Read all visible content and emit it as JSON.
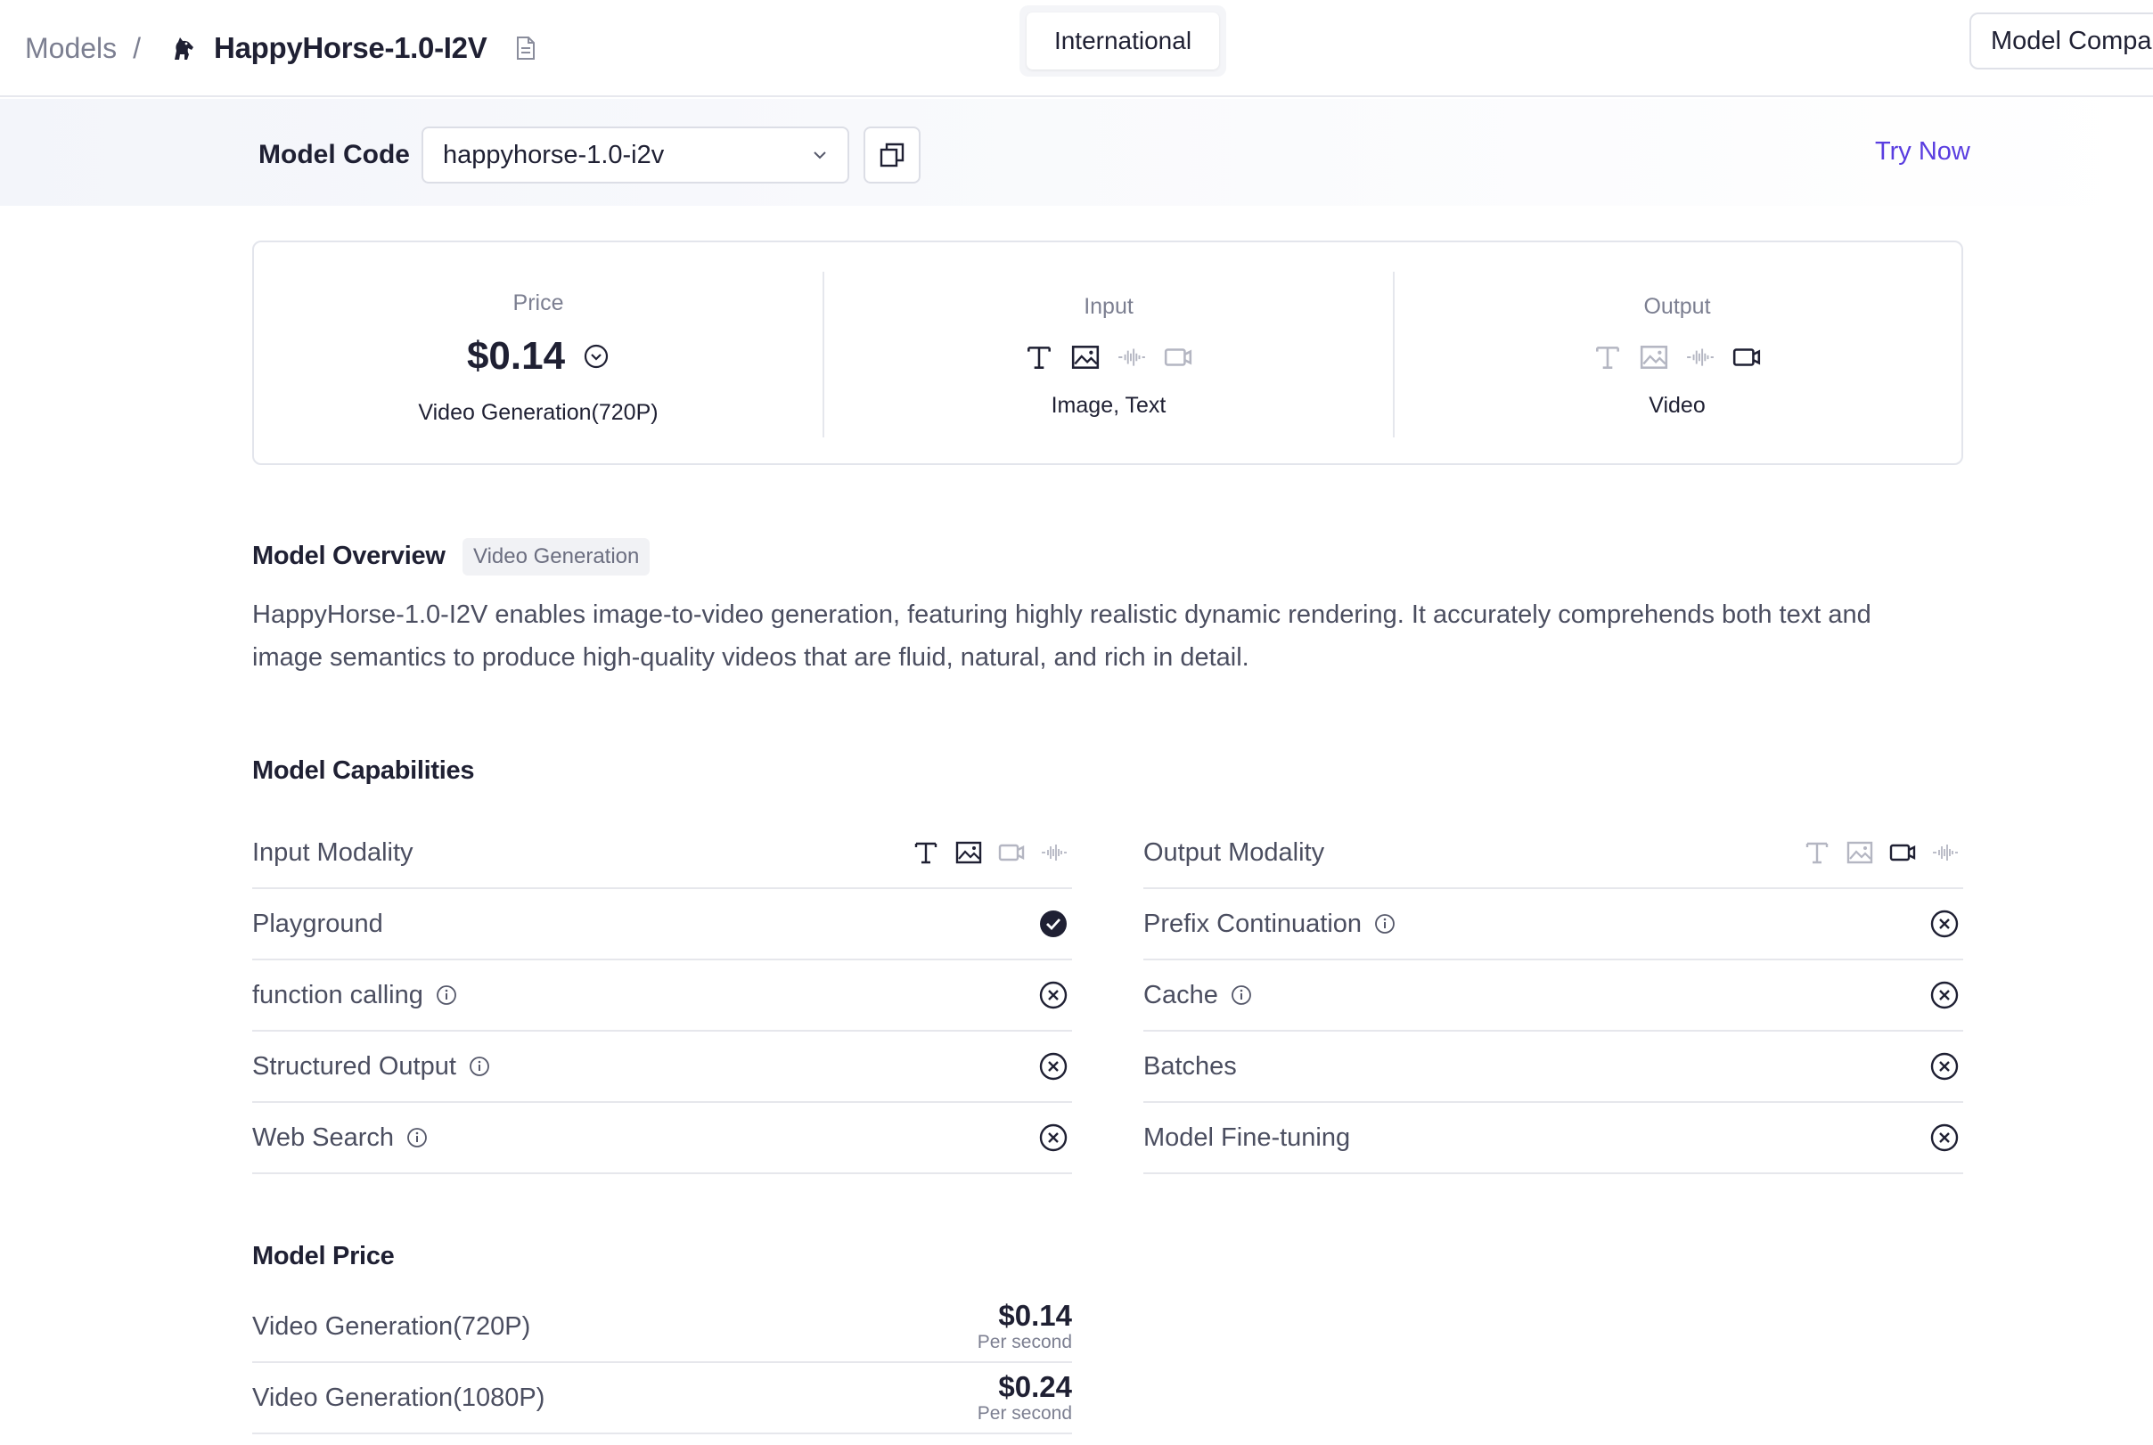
{
  "breadcrumb": {
    "parent": "Models",
    "separator": "/",
    "title": "HappyHorse-1.0-I2V"
  },
  "region": {
    "label": "International"
  },
  "header_actions": {
    "compare_label": "Model Compar"
  },
  "model_code": {
    "label": "Model Code",
    "value": "happyhorse-1.0-i2v",
    "try_now": "Try Now"
  },
  "summary": {
    "price": {
      "heading": "Price",
      "amount": "$0.14",
      "sub": "Video Generation(720P)"
    },
    "input": {
      "heading": "Input",
      "sub": "Image, Text",
      "icons": [
        "text-icon",
        "image-icon",
        "audio-icon",
        "video-icon"
      ],
      "active": [
        true,
        true,
        false,
        false
      ]
    },
    "output": {
      "heading": "Output",
      "sub": "Video",
      "icons": [
        "text-icon",
        "image-icon",
        "audio-icon",
        "video-icon"
      ],
      "active": [
        false,
        false,
        false,
        true
      ]
    }
  },
  "overview": {
    "title": "Model Overview",
    "tag": "Video Generation",
    "description": "HappyHorse-1.0-I2V enables image-to-video generation, featuring highly realistic dynamic rendering. It accurately comprehends both text and image semantics to produce high-quality videos that are fluid, natural, and rich in detail."
  },
  "capabilities": {
    "title": "Model Capabilities",
    "left": [
      {
        "label": "Input Modality",
        "type": "modality",
        "icons": [
          "text-icon",
          "image-icon",
          "video-icon",
          "audio-icon"
        ],
        "active": [
          true,
          true,
          false,
          false
        ]
      },
      {
        "label": "Playground",
        "type": "status",
        "supported": true,
        "info": false
      },
      {
        "label": "function calling",
        "type": "status",
        "supported": false,
        "info": true
      },
      {
        "label": "Structured Output",
        "type": "status",
        "supported": false,
        "info": true
      },
      {
        "label": "Web Search",
        "type": "status",
        "supported": false,
        "info": true
      }
    ],
    "right": [
      {
        "label": "Output Modality",
        "type": "modality",
        "icons": [
          "text-icon",
          "image-icon",
          "video-icon",
          "audio-icon"
        ],
        "active": [
          false,
          false,
          true,
          false
        ]
      },
      {
        "label": "Prefix Continuation",
        "type": "status",
        "supported": false,
        "info": true
      },
      {
        "label": "Cache",
        "type": "status",
        "supported": false,
        "info": true
      },
      {
        "label": "Batches",
        "type": "status",
        "supported": false,
        "info": false
      },
      {
        "label": "Model Fine-tuning",
        "type": "status",
        "supported": false,
        "info": false
      }
    ]
  },
  "pricing": {
    "title": "Model Price",
    "rows": [
      {
        "label": "Video Generation(720P)",
        "amount": "$0.14",
        "unit": "Per second"
      },
      {
        "label": "Video Generation(1080P)",
        "amount": "$0.24",
        "unit": "Per second"
      }
    ]
  },
  "colors": {
    "accent": "#5a3ee0",
    "text_dark": "#1f2033",
    "text_muted": "#7c7f91",
    "icon_inactive": "#b4b6c2"
  }
}
